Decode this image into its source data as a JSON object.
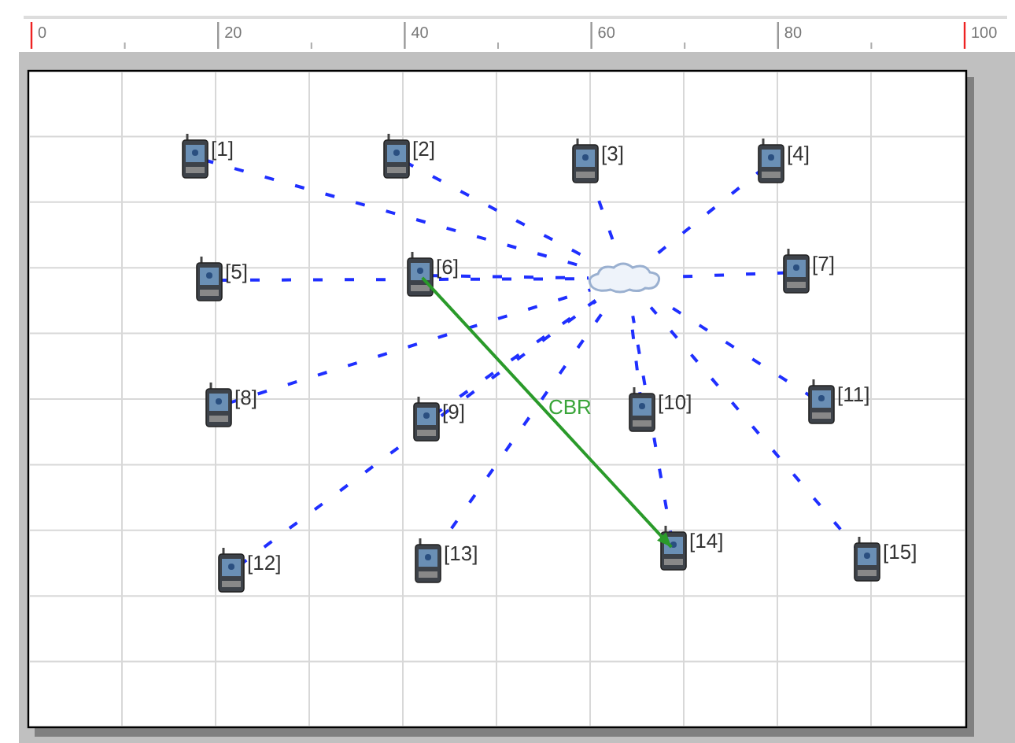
{
  "ruler": {
    "labels": [
      "0",
      "20",
      "40",
      "60",
      "80",
      "100"
    ]
  },
  "canvas": {
    "nodes": [
      {
        "label": "[1]"
      },
      {
        "label": "[2]"
      },
      {
        "label": "[3]"
      },
      {
        "label": "[4]"
      },
      {
        "label": "[5]"
      },
      {
        "label": "[6]"
      },
      {
        "label": "[7]"
      },
      {
        "label": "[8]"
      },
      {
        "label": "[9]"
      },
      {
        "label": "[10]"
      },
      {
        "label": "[11]"
      },
      {
        "label": "[12]"
      },
      {
        "label": "[13]"
      },
      {
        "label": "[14]"
      },
      {
        "label": "[15]"
      }
    ],
    "flows": [
      {
        "label": "CBR"
      }
    ]
  }
}
